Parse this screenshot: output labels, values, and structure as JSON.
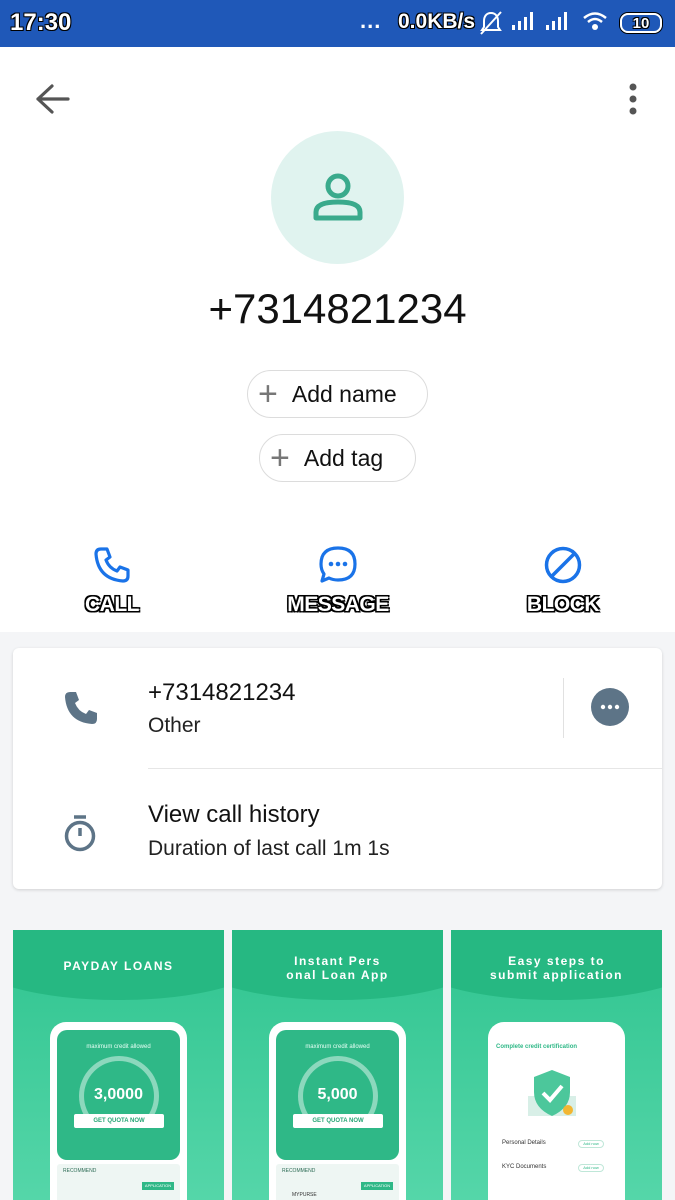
{
  "status_bar": {
    "time": "17:30",
    "dots": "...",
    "net_speed": "0.0KB/s",
    "battery": "10",
    "bar_color": "#1f58b8"
  },
  "header": {
    "back_icon": "arrow-left-icon",
    "more_icon": "more-vertical-icon"
  },
  "contact": {
    "number": "+7314821234",
    "avatar_icon": "person-icon",
    "add_name_label": "Add name",
    "add_tag_label": "Add tag"
  },
  "actions": [
    {
      "label": "CALL",
      "icon": "phone-icon",
      "color": "#1a73e8"
    },
    {
      "label": "MESSAGE",
      "icon": "chat-bubble-icon",
      "color": "#1a73e8"
    },
    {
      "label": "BLOCK",
      "icon": "block-icon",
      "color": "#1a73e8"
    }
  ],
  "details": {
    "phone_row": {
      "number": "+7314821234",
      "type": "Other"
    },
    "history_row": {
      "title": "View call history",
      "subtitle": "Duration of last call 1m 1s"
    }
  },
  "ads": [
    {
      "title": "PAYDAY LOANS",
      "caption": "maximum credit allowed",
      "amount": "3,0000",
      "button": "GET QUOTA NOW",
      "rec_label": "RECOMMEND",
      "rec_button": "APPLICATION"
    },
    {
      "title_line1": "Instant Pers",
      "title_line2": "onal Loan App",
      "caption": "maximum credit allowed",
      "amount": "5,000",
      "button": "GET QUOTA NOW",
      "rec_label": "RECOMMEND",
      "rec_button": "APPLICATION",
      "rec_name": "MYPURSE"
    },
    {
      "title_line1": "Easy steps to",
      "title_line2": "submit application",
      "header": "Complete credit certification",
      "row1": "Personal Details",
      "row2": "KYC Documents",
      "row_button": "Add now"
    }
  ]
}
